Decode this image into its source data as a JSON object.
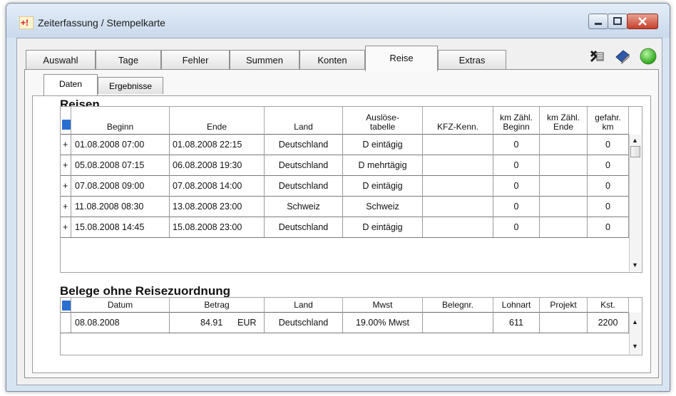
{
  "window": {
    "title": "Zeiterfassung / Stempelkarte"
  },
  "tabs": [
    "Auswahl",
    "Tage",
    "Fehler",
    "Summen",
    "Konten",
    "Reise",
    "Extras"
  ],
  "active_tab": "Reise",
  "subtabs": [
    "Daten",
    "Ergebnisse"
  ],
  "active_subtab": "Daten",
  "toolbar_icons": [
    "excel-icon",
    "book-icon",
    "status-green-icon"
  ],
  "reisen": {
    "title": "Reisen",
    "headers": [
      "Beginn",
      "Ende",
      "Land",
      "Auslöse-\ntabelle",
      "KFZ-Kenn.",
      "km Zähl.\nBeginn",
      "km Zähl.\nEnde",
      "gefahr.\nkm"
    ],
    "rows": [
      {
        "beginn": "01.08.2008  07:00",
        "ende": "01.08.2008  22:15",
        "land": "Deutschland",
        "ausloese": "D eintägig",
        "kfz": "",
        "km_beginn": "0",
        "km_ende": "",
        "km": "0"
      },
      {
        "beginn": "05.08.2008  07:15",
        "ende": "06.08.2008  19:30",
        "land": "Deutschland",
        "ausloese": "D mehrtägig",
        "kfz": "",
        "km_beginn": "0",
        "km_ende": "",
        "km": "0"
      },
      {
        "beginn": "07.08.2008  09:00",
        "ende": "07.08.2008  14:00",
        "land": "Deutschland",
        "ausloese": "D eintägig",
        "kfz": "",
        "km_beginn": "0",
        "km_ende": "",
        "km": "0"
      },
      {
        "beginn": "11.08.2008  08:30",
        "ende": "13.08.2008  23:00",
        "land": "Schweiz",
        "ausloese": "Schweiz",
        "kfz": "",
        "km_beginn": "0",
        "km_ende": "",
        "km": "0"
      },
      {
        "beginn": "15.08.2008  14:45",
        "ende": "15.08.2008  23:00",
        "land": "Deutschland",
        "ausloese": "D eintägig",
        "kfz": "",
        "km_beginn": "0",
        "km_ende": "",
        "km": "0"
      }
    ]
  },
  "belege": {
    "title": "Belege ohne Reisezuordnung",
    "headers": [
      "Datum",
      "Betrag",
      "Land",
      "Mwst",
      "Belegnr.",
      "Lohnart",
      "Projekt",
      "Kst."
    ],
    "rows": [
      {
        "datum": "08.08.2008",
        "betrag": "84.91",
        "waehrung": "EUR",
        "land": "Deutschland",
        "mwst": "19.00% Mwst",
        "belegnr": "",
        "lohnart": "611",
        "projekt": "",
        "kst": "2200"
      }
    ]
  },
  "colors": {
    "accent": "#2a6fd0",
    "title_bar": "#c9d9ec",
    "close_button": "#c7402b"
  }
}
